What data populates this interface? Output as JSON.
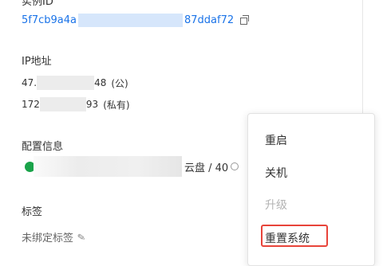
{
  "instance": {
    "id_label_cut": "实例ID",
    "id_prefix": "5f7cb9a4a",
    "id_suffix": "87ddaf72"
  },
  "ip": {
    "label": "IP地址",
    "public_prefix": "47.",
    "public_suffix": "48",
    "public_tag": "(公)",
    "private_prefix": "172",
    "private_suffix": "93",
    "private_tag": "(私有)"
  },
  "config": {
    "label": "配置信息",
    "disk_text": "云盘 / 40"
  },
  "tags": {
    "label": "标签",
    "unbound": "未绑定标签"
  },
  "menu": {
    "items": [
      "重启",
      "关机",
      "升级",
      "重置系统"
    ],
    "disabled": [
      "升级"
    ],
    "highlighted": "重置系统"
  },
  "icons": [
    "copy-icon",
    "pencil-icon",
    "status-dot"
  ],
  "colors": {
    "link": "#1a73e8",
    "status_running": "#1aa34a",
    "highlight_border": "#e8443a",
    "disabled_text": "#b3b3b3"
  }
}
